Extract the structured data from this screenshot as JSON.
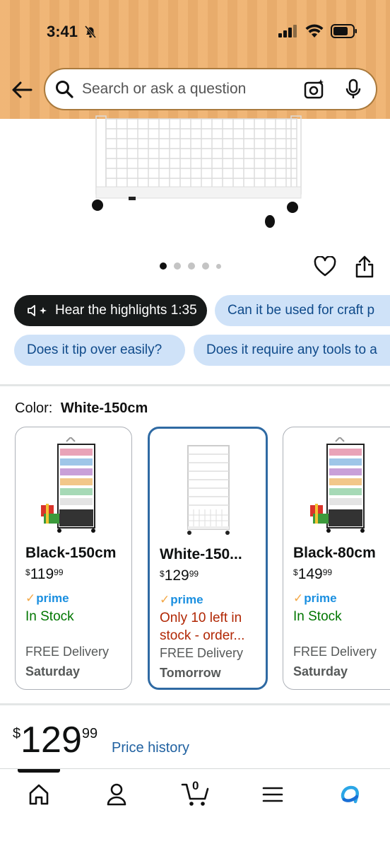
{
  "status_bar": {
    "time": "3:41"
  },
  "search": {
    "placeholder": "Search or ask a question"
  },
  "gallery": {
    "image_count": 5,
    "active_index": 0
  },
  "chips": {
    "highlights": "Hear the highlights 1:35",
    "q1": "Can it be used for craft p",
    "q2": "Does it tip over easily?",
    "q3": "Does it require any tools to a"
  },
  "color": {
    "label": "Color:",
    "selected": "White-150cm"
  },
  "variants": [
    {
      "name": "Black-150cm",
      "price_sym": "$",
      "price_whole": "119",
      "price_frac": "99",
      "prime": "prime",
      "stock": "In Stock",
      "delivery_label": "FREE Delivery",
      "delivery_day": "Saturday"
    },
    {
      "name": "White-150...",
      "price_sym": "$",
      "price_whole": "129",
      "price_frac": "99",
      "prime": "prime",
      "stock": "Only 10 left in stock - order...",
      "delivery_label": "FREE Delivery",
      "delivery_day": "Tomorrow"
    },
    {
      "name": "Black-80cm",
      "price_sym": "$",
      "price_whole": "149",
      "price_frac": "99",
      "prime": "prime",
      "stock": "In Stock",
      "delivery_label": "FREE Delivery",
      "delivery_day": "Saturday"
    }
  ],
  "price": {
    "sym": "$",
    "whole": "129",
    "frac": "99",
    "history_link": "Price history"
  },
  "cart": {
    "count": "0"
  },
  "colors": {
    "header": "#efb26f",
    "prime_blue": "#1a8fe0",
    "in_stock": "#007600",
    "low_stock": "#b12704",
    "selected_border": "#2f6aa3",
    "link": "#2162a1"
  }
}
